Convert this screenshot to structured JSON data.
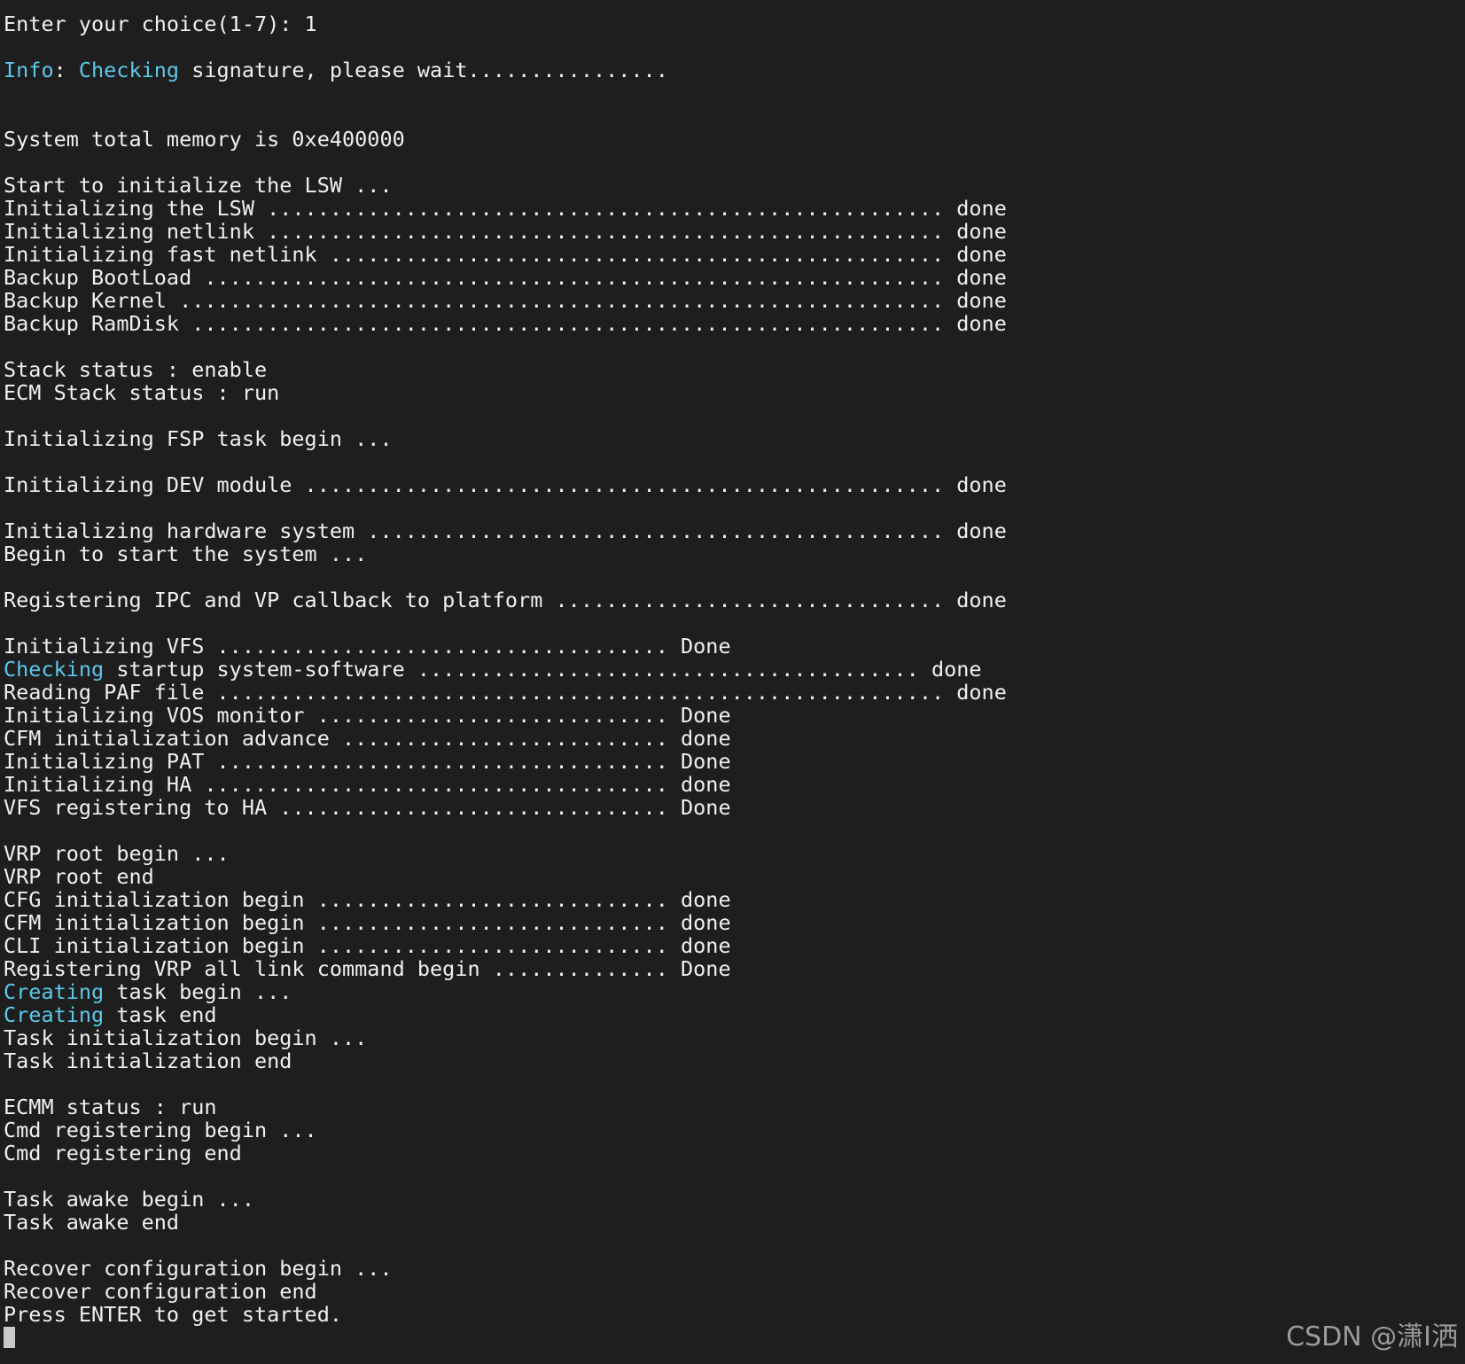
{
  "terminal": {
    "highlight_color": "#5cc8ea",
    "text_color": "#f0f0f0",
    "background": "#1e1e1e",
    "lines": [
      [
        {
          "t": "Enter your choice(1-7): 1"
        }
      ],
      [],
      [
        {
          "t": "Info",
          "hl": true
        },
        {
          "t": ": "
        },
        {
          "t": "Checking",
          "hl": true
        },
        {
          "t": " signature, please wait................"
        }
      ],
      [],
      [],
      [
        {
          "t": "System total memory is 0xe400000"
        }
      ],
      [],
      [
        {
          "t": "Start to initialize the LSW ..."
        }
      ],
      [
        {
          "t": "Initializing the LSW ...................................................... done"
        }
      ],
      [
        {
          "t": "Initializing netlink ...................................................... done"
        }
      ],
      [
        {
          "t": "Initializing fast netlink ................................................. done"
        }
      ],
      [
        {
          "t": "Backup BootLoad ........................................................... done"
        }
      ],
      [
        {
          "t": "Backup Kernel ............................................................. done"
        }
      ],
      [
        {
          "t": "Backup RamDisk ............................................................ done"
        }
      ],
      [],
      [
        {
          "t": "Stack status : enable"
        }
      ],
      [
        {
          "t": "ECM Stack status : run"
        }
      ],
      [],
      [
        {
          "t": "Initializing FSP task begin ..."
        }
      ],
      [],
      [
        {
          "t": "Initializing DEV module ................................................... done"
        }
      ],
      [],
      [
        {
          "t": "Initializing hardware system .............................................. done"
        }
      ],
      [
        {
          "t": "Begin to start the system ..."
        }
      ],
      [],
      [
        {
          "t": "Registering IPC and VP callback to platform ............................... done"
        }
      ],
      [],
      [
        {
          "t": "Initializing VFS .................................... Done"
        }
      ],
      [
        {
          "t": "Checking",
          "hl": true
        },
        {
          "t": " startup system-software ........................................ done"
        }
      ],
      [
        {
          "t": "Reading PAF file .......................................................... done"
        }
      ],
      [
        {
          "t": "Initializing VOS monitor ............................ Done"
        }
      ],
      [
        {
          "t": "CFM initialization advance .......................... done"
        }
      ],
      [
        {
          "t": "Initializing PAT .................................... Done"
        }
      ],
      [
        {
          "t": "Initializing HA ..................................... done"
        }
      ],
      [
        {
          "t": "VFS registering to HA ............................... Done"
        }
      ],
      [],
      [
        {
          "t": "VRP root begin ..."
        }
      ],
      [
        {
          "t": "VRP root end"
        }
      ],
      [
        {
          "t": "CFG initialization begin ............................ done"
        }
      ],
      [
        {
          "t": "CFM initialization begin ............................ done"
        }
      ],
      [
        {
          "t": "CLI initialization begin ............................ done"
        }
      ],
      [
        {
          "t": "Registering VRP all link command begin .............. Done"
        }
      ],
      [
        {
          "t": "Creating",
          "hl": true
        },
        {
          "t": " task begin ..."
        }
      ],
      [
        {
          "t": "Creating",
          "hl": true
        },
        {
          "t": " task end"
        }
      ],
      [
        {
          "t": "Task initialization begin ..."
        }
      ],
      [
        {
          "t": "Task initialization end"
        }
      ],
      [],
      [
        {
          "t": "ECMM status : run"
        }
      ],
      [
        {
          "t": "Cmd registering begin ..."
        }
      ],
      [
        {
          "t": "Cmd registering end"
        }
      ],
      [],
      [
        {
          "t": "Task awake begin ..."
        }
      ],
      [
        {
          "t": "Task awake end"
        }
      ],
      [],
      [
        {
          "t": "Recover configuration begin ..."
        }
      ],
      [
        {
          "t": "Recover configuration end"
        }
      ],
      [
        {
          "t": "Press ENTER to get started."
        }
      ]
    ]
  },
  "watermark": "CSDN @潇I洒"
}
